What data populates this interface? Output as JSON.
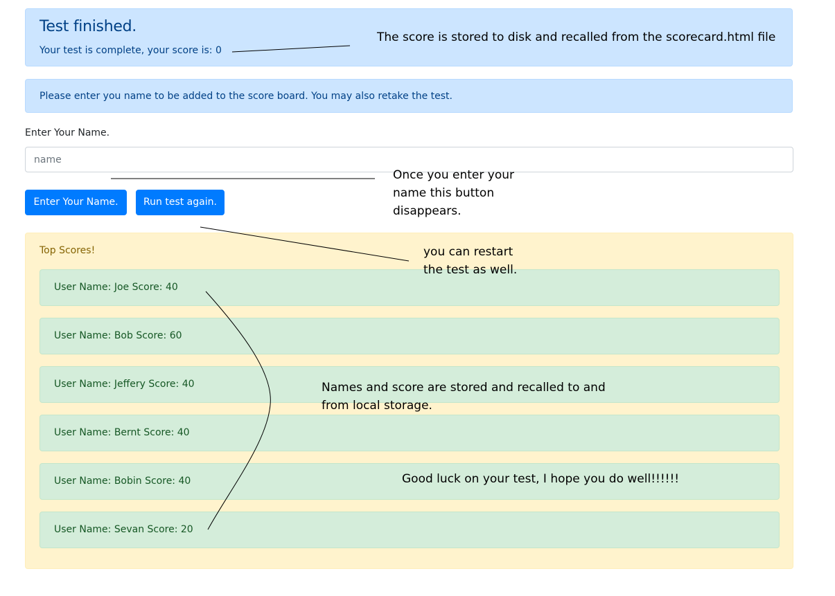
{
  "header": {
    "title": "Test finished.",
    "score_line": "Your test is complete, your score is: 0"
  },
  "info": {
    "message": "Please enter you name to be added to the score board. You may also retake the test."
  },
  "form": {
    "label": "Enter Your Name.",
    "placeholder": "name",
    "enter_button": "Enter Your Name.",
    "rerun_button": "Run test again."
  },
  "scoreboard": {
    "heading": "Top Scores!",
    "entries": [
      "User Name: Joe Score: 40",
      "User Name: Bob Score: 60",
      "User Name: Jeffery Score: 40",
      "User Name: Bernt Score: 40",
      "User Name: Bobin Score: 40",
      "User Name: Sevan Score: 20"
    ]
  },
  "annotations": {
    "storage_note": "The score is stored to disk and recalled from the scorecard.html file",
    "button_note": "Once you enter your name this button disappears.",
    "restart_note": "you can restart the test as well.",
    "local_storage_note": "Names and score are stored and recalled to and from local storage.",
    "good_luck": "Good luck on your test, I hope you do well!!!!!!"
  },
  "colors": {
    "primary": "#007bff",
    "info_bg": "#cce5ff",
    "warning_bg": "#fff3cd",
    "success_bg": "#d4edda"
  }
}
